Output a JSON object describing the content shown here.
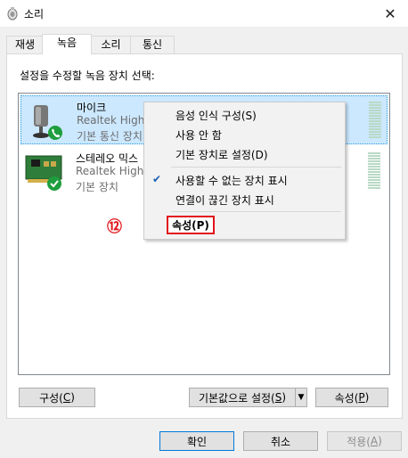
{
  "window": {
    "title": "소리"
  },
  "tabs": [
    {
      "label": "재생"
    },
    {
      "label": "녹음"
    },
    {
      "label": "소리"
    },
    {
      "label": "통신"
    }
  ],
  "panel": {
    "instruction": "설정을 수정할 녹음 장치 선택:"
  },
  "devices": [
    {
      "name": "마이크",
      "line2": "Realtek High D",
      "line3": "기본 통신 장치"
    },
    {
      "name": "스테레오 믹스",
      "line2": "Realtek High D",
      "line3": "기본 장치"
    }
  ],
  "context_menu": {
    "items": [
      {
        "label": "음성 인식 구성(S)"
      },
      {
        "label": "사용 안 함"
      },
      {
        "label": "기본 장치로 설정(D)"
      },
      {
        "label": "사용할 수 없는 장치 표시",
        "checked": true
      },
      {
        "label": "연결이 끊긴 장치 표시"
      },
      {
        "label": "속성(P)"
      }
    ]
  },
  "annotation": "⑫",
  "panel_buttons": {
    "configure": {
      "text": "구성(",
      "key": "C",
      "end": ")"
    },
    "set_default": {
      "text": "기본값으로 설정(",
      "key": "S",
      "end": ")"
    },
    "properties": {
      "text": "속성(",
      "key": "P",
      "end": ")"
    }
  },
  "footer_buttons": {
    "ok": "확인",
    "cancel": "취소",
    "apply": {
      "text": "적용(",
      "key": "A",
      "end": ")"
    }
  },
  "colors": {
    "accent": "#26a0da",
    "selection": "#cce8ff",
    "annotation": "#e1131a",
    "status_green": "#1e9e3e"
  }
}
